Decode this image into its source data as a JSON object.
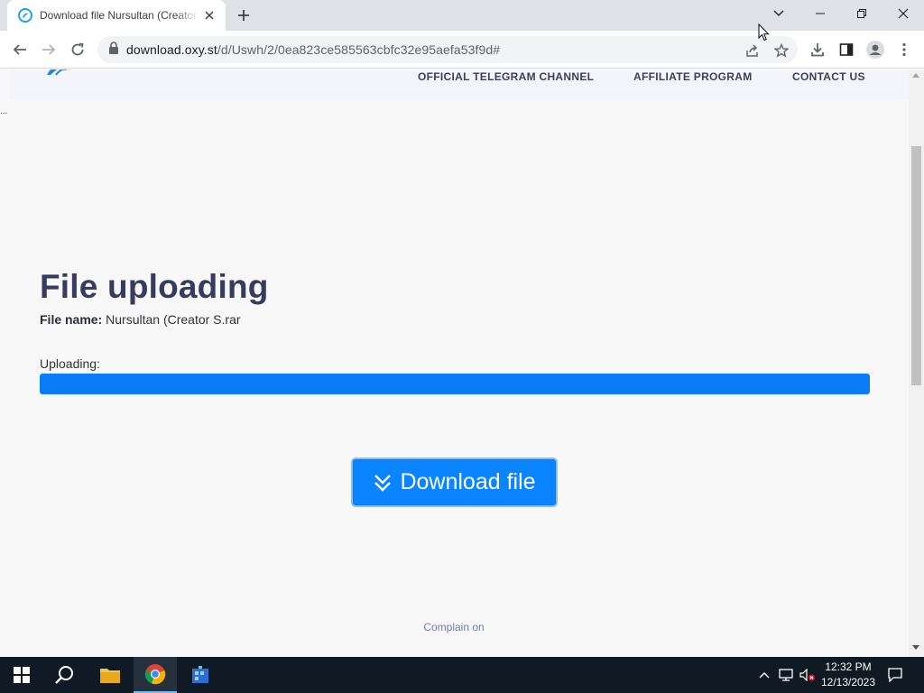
{
  "browser": {
    "tab": {
      "title": "Download file Nursultan (Creator S.rar",
      "close_glyph": "✕",
      "favicon": "oxy-logo-icon"
    },
    "new_tab_icon": "plus-icon",
    "window_controls": [
      "chevron-down-icon",
      "minimize-icon",
      "restore-icon",
      "close-icon"
    ],
    "toolbar": {
      "back_icon": "arrow-left-icon",
      "forward_icon": "arrow-right-icon",
      "reload_icon": "reload-icon",
      "lock_icon": "lock-icon",
      "url_domain": "download.oxy.st",
      "url_path": "/d/Uswh/2/0ea823ce585563cbfc32e95aefa53f9d#",
      "right_icons": [
        "share-icon",
        "star-icon",
        "download-icon",
        "side-panel-icon",
        "profile-icon",
        "kebab-menu-icon"
      ]
    }
  },
  "site": {
    "nav": {
      "links": [
        "OFFICIAL TELEGRAM CHANNEL",
        "AFFILIATE PROGRAM",
        "CONTACT US"
      ]
    },
    "ellipsis": "...",
    "title": "File uploading",
    "file_name_label": "File name:",
    "file_name_value": "Nursultan (Creator S.rar",
    "uploading_label": "Uploading:",
    "upload_progress": 1.0,
    "download_button_label": "Download file",
    "complain_text": "Complain on"
  },
  "taskbar": {
    "items": [
      "windows-start-icon",
      "search-icon",
      "file-explorer-icon",
      "chrome-icon",
      "app-icon"
    ],
    "active_item": "chrome-icon",
    "tray": [
      "chevron-up-icon",
      "network-icon",
      "volume-muted-icon",
      "notification-icon"
    ],
    "time": "12:32 PM",
    "date": "12/13/2023"
  },
  "colors": {
    "accent_blue": "#0a84ff",
    "progress_blue": "#0a7cf8",
    "title_navy": "#363c60",
    "taskbar": "#101a24"
  }
}
